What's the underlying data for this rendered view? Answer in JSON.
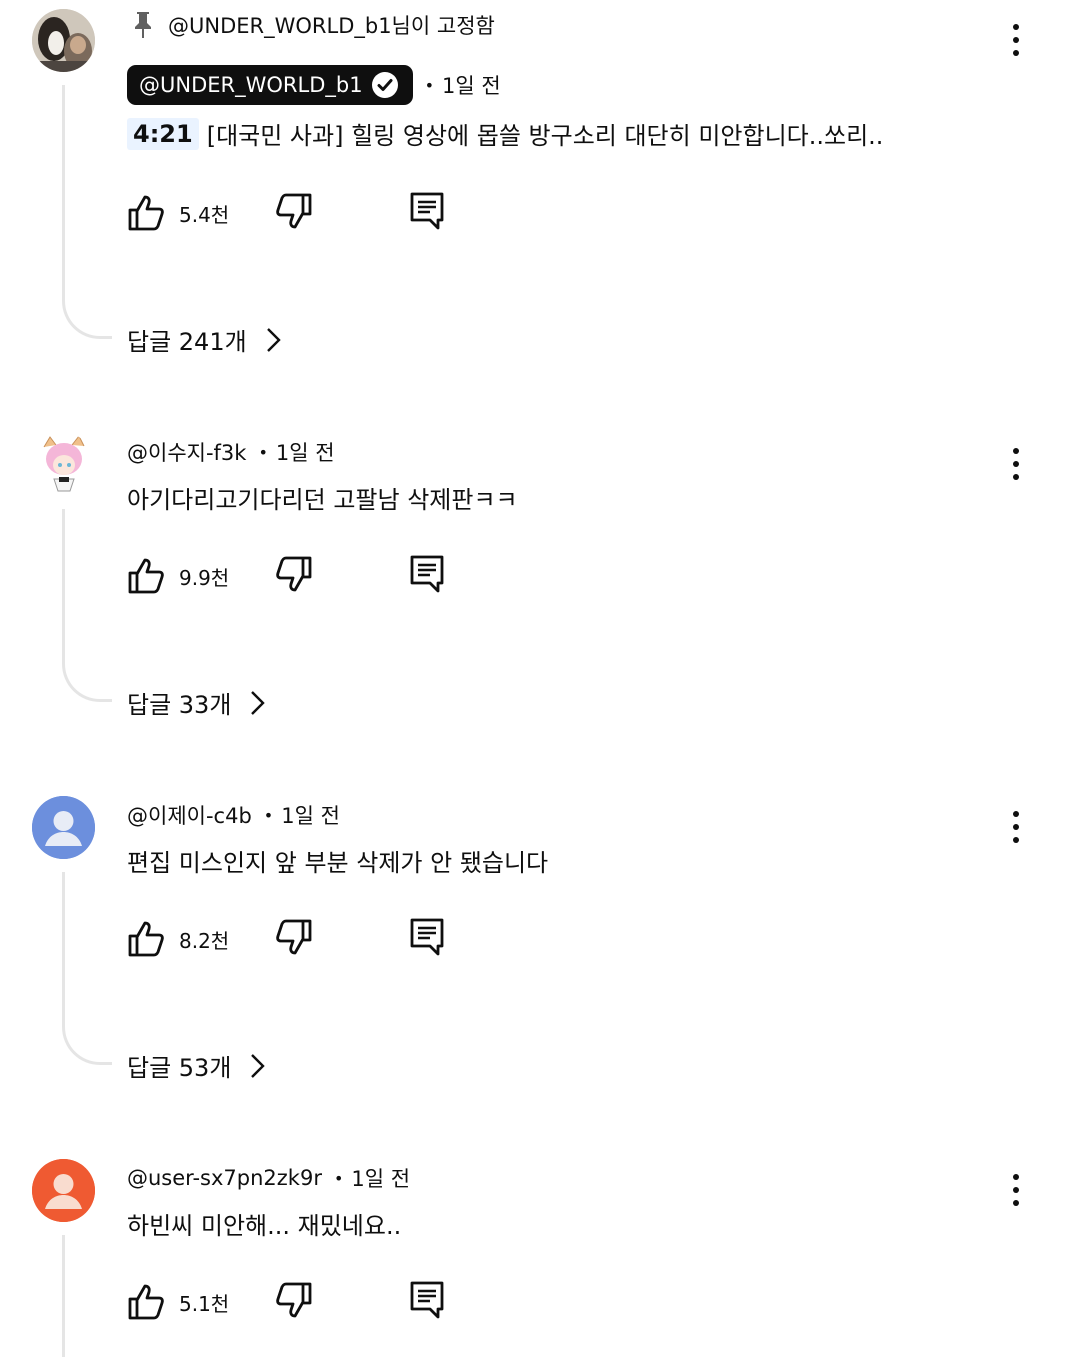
{
  "comments": [
    {
      "pinned_label": "@UNDER_WORLD_b1님이 고정함",
      "author": "@UNDER_WORLD_b1",
      "time": "1일 전",
      "timestamp_link": "4:21",
      "text": "[대국민 사과] 힐링 영상에 몹쓸 방구소리 대단히 미안합니다..쏘리..",
      "likes": "5.4천",
      "replies": "답글 241개",
      "avatar_type": "photo",
      "verified": true
    },
    {
      "author": "@이수지-f3k",
      "time": "1일 전",
      "text": "아기다리고기다리던 고팔남 삭제판ㅋㅋ",
      "likes": "9.9천",
      "replies": "답글 33개",
      "avatar_type": "anime"
    },
    {
      "author": "@이제이-c4b",
      "time": "1일 전",
      "text": "편집 미스인지 앞 부분 삭제가 안 됐습니다",
      "likes": "8.2천",
      "replies": "답글 53개",
      "avatar_type": "default",
      "avatar_color": "#6c8fdd"
    },
    {
      "author": "@user-sx7pn2zk9r",
      "time": "1일 전",
      "text": "하빈씨 미안해... 재밌네요..",
      "likes": "5.1천",
      "avatar_type": "default",
      "avatar_color": "#ef5a32"
    }
  ],
  "meta_separator": "•",
  "icons": [
    "pin-icon",
    "verified-check-icon",
    "thumbs-up-icon",
    "thumbs-down-icon",
    "reply-icon",
    "chevron-right-icon",
    "more-vert-icon"
  ]
}
